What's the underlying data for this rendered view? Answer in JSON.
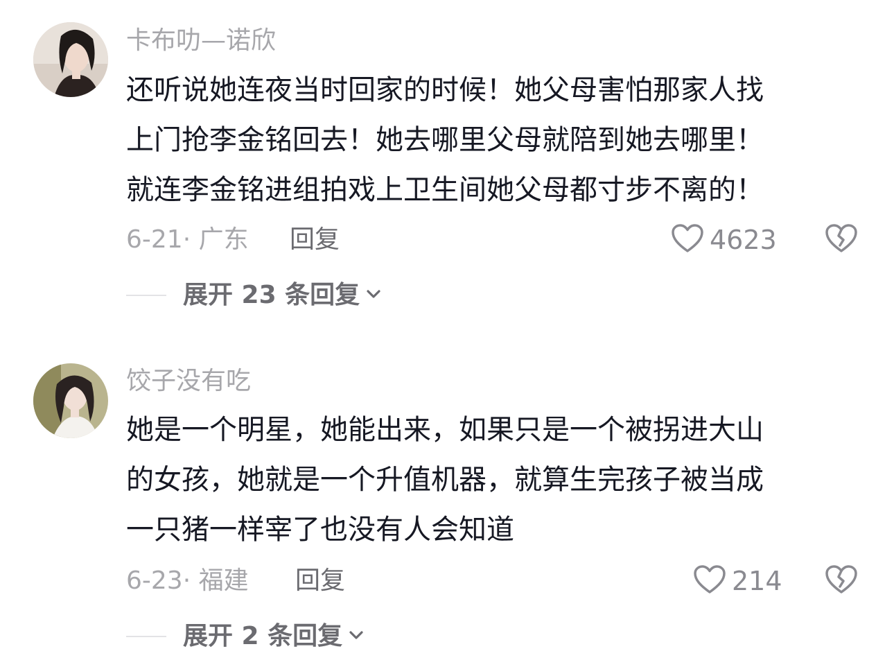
{
  "comments": [
    {
      "username": "卡布叻—诺欣",
      "lines": [
        "还听说她连夜当时回家的时候！她父母害怕那家人找",
        "上门抢李金铭回去！她去哪里父母就陪到她去哪里！",
        "就连李金铭进组拍戏上卫生间她父母都寸步不离的！"
      ],
      "date_location": "6-21· 广东",
      "reply_label": "回复",
      "likes": "4623",
      "expand_label": "展开 23 条回复"
    },
    {
      "username": "饺子没有吃",
      "lines": [
        "她是一个明星，她能出来，如果只是一个被拐进大山",
        "的女孩，她就是一个升值机器，就算生完孩子被当成",
        "一只猪一样宰了也没有人会知道"
      ],
      "date_location": "6-23· 福建",
      "reply_label": "回复",
      "likes": "214",
      "expand_label": "展开 2 条回复"
    }
  ],
  "icons": {
    "like": "heart-outline-icon",
    "dislike": "broken-heart-icon",
    "expand": "chevron-down-icon"
  },
  "colors": {
    "username": "#a7a7ab",
    "text": "#161823",
    "meta": "#a7a7ab",
    "action": "#6b6b70"
  }
}
